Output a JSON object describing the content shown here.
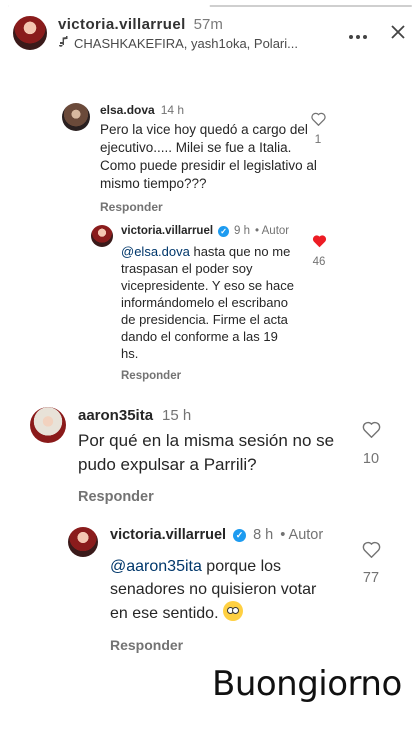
{
  "story": {
    "username": "victoria.villarruel",
    "time": "57m",
    "music": "CHASHKAKEFIRA, yash1oka, Polari..."
  },
  "comments": [
    {
      "user": "elsa.dova",
      "time": "14 h",
      "text": "Pero la vice hoy  quedó a cargo del ejecutivo..... Milei se fue a Italia. Como puede presidir el legislativo al mismo tiempo???",
      "likes": "1",
      "reply_label": "Responder"
    },
    {
      "user": "victoria.villarruel",
      "time": "9 h",
      "author_tag": "• Autor",
      "mention": "@elsa.dova",
      "text": " hasta que no me traspasan el poder soy vicepresidente. Y eso se hace informándomelo el escribano de presidencia. Firme el acta dando el conforme a las 19 hs.",
      "likes": "46",
      "reply_label": "Responder"
    },
    {
      "user": "aaron35ita",
      "time": "15 h",
      "text": "Por qué en la misma sesión no se pudo expulsar a Parrili?",
      "likes": "10",
      "reply_label": "Responder"
    },
    {
      "user": "victoria.villarruel",
      "time": "8 h",
      "author_tag": "• Autor",
      "mention": "@aaron35ita",
      "text": " porque los senadores no quisieron votar en ese sentido.",
      "likes": "77",
      "reply_label": "Responder"
    }
  ],
  "overlay_text": "Buongiorno",
  "icons": {
    "more": "more-dots-icon",
    "close": "close-icon",
    "music": "music-note-icon",
    "heart": "heart-icon",
    "verified": "verified-badge-icon"
  },
  "colors": {
    "mention": "#00376b",
    "liked_heart": "#ed1c24",
    "verified": "#1d9bf0"
  }
}
